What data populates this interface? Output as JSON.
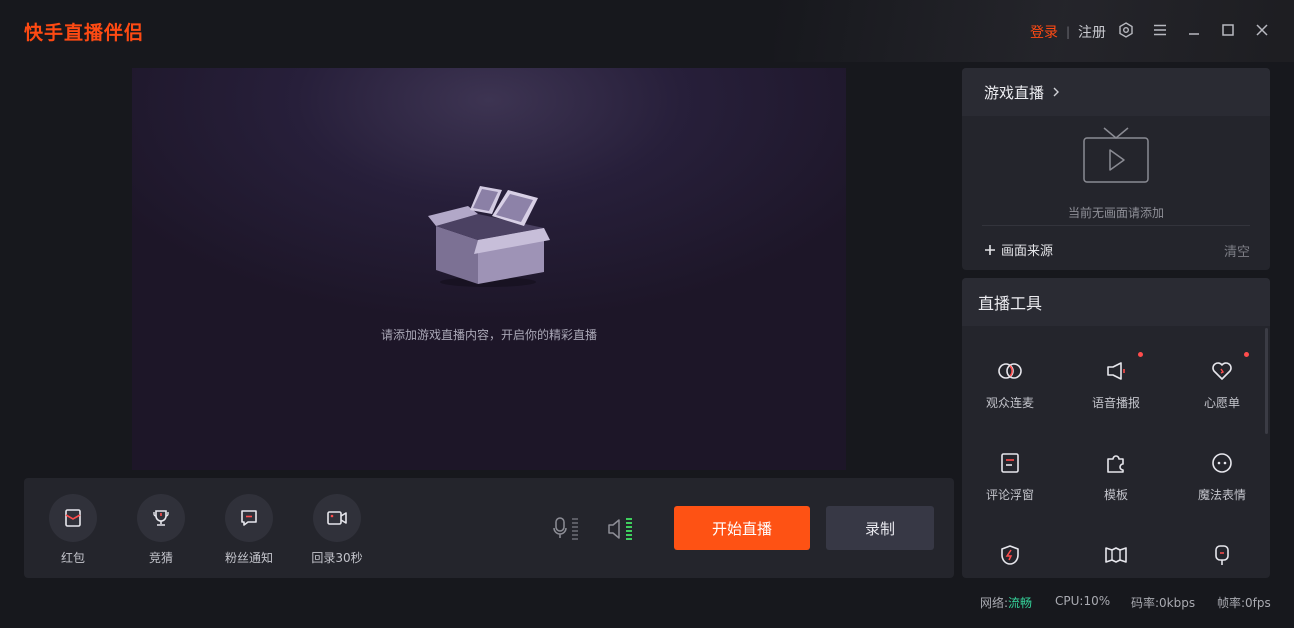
{
  "app": {
    "title": "快手直播伴侣"
  },
  "header": {
    "login": "登录",
    "separator": "|",
    "register": "注册"
  },
  "window_controls": [
    "settings-icon",
    "menu-icon",
    "minimize-icon",
    "maximize-icon",
    "close-icon"
  ],
  "preview": {
    "hint": "请添加游戏直播内容，开启你的精彩直播"
  },
  "toolbar": {
    "tools": [
      {
        "label": "红包",
        "icon": "red-packet-icon"
      },
      {
        "label": "竞猜",
        "icon": "trophy-icon"
      },
      {
        "label": "粉丝通知",
        "icon": "fan-notice-icon"
      },
      {
        "label": "回录30秒",
        "icon": "replay-camera-icon"
      }
    ],
    "start_live": "开始直播",
    "record": "录制"
  },
  "game_panel": {
    "title": "游戏直播",
    "empty_text": "当前无画面请添加",
    "add_source": "画面来源",
    "clear": "清空"
  },
  "tools_panel": {
    "title": "直播工具",
    "items": [
      {
        "label": "观众连麦",
        "icon": "audience-link-icon",
        "dot": false
      },
      {
        "label": "语音播报",
        "icon": "voice-broadcast-icon",
        "dot": true
      },
      {
        "label": "心愿单",
        "icon": "wishlist-heart-icon",
        "dot": true
      },
      {
        "label": "评论浮窗",
        "icon": "comment-float-icon",
        "dot": false
      },
      {
        "label": "模板",
        "icon": "template-puzzle-icon",
        "dot": false
      },
      {
        "label": "魔法表情",
        "icon": "magic-face-icon",
        "dot": false
      },
      {
        "label": "",
        "icon": "shield-bolt-icon",
        "dot": false
      },
      {
        "label": "",
        "icon": "book-icon",
        "dot": false
      },
      {
        "label": "",
        "icon": "mic-stand-icon",
        "dot": false
      }
    ]
  },
  "status": {
    "network_label": "网络:",
    "network_value": "流畅",
    "cpu": "CPU:10%",
    "bitrate": "码率:0kbps",
    "fps": "帧率:0fps"
  },
  "colors": {
    "accent": "#fe5214",
    "brand": "#fe4a13",
    "status_ok": "#35d29a",
    "dot": "#ff4c4c"
  }
}
